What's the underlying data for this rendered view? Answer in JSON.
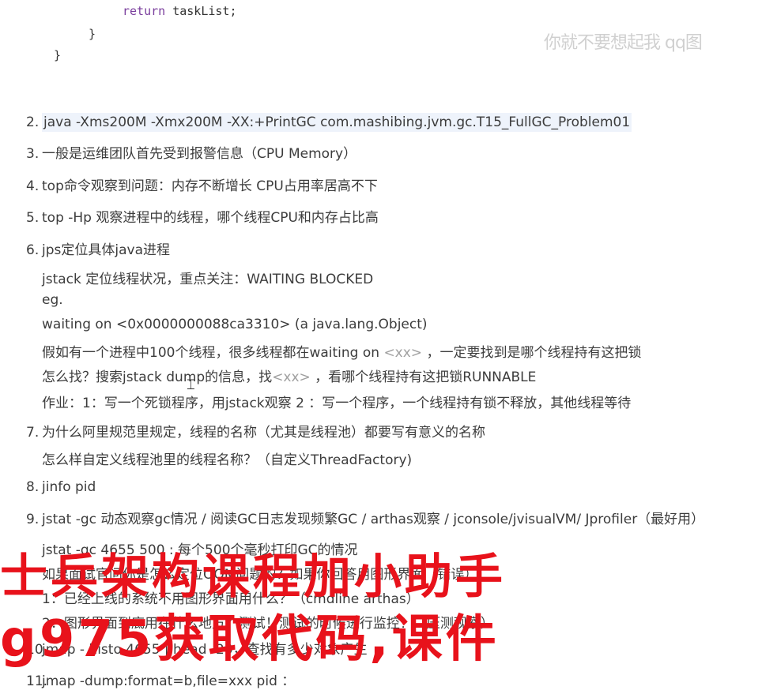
{
  "code": {
    "return_keyword": "return",
    "return_rest": " taskList;",
    "brace_inner": "}",
    "brace_outer": "}"
  },
  "watermark_top": "你就不要想起我 qq图",
  "items": [
    {
      "num": "2.",
      "text": "java -Xms200M -Xmx200M -XX:+PrintGC com.mashibing.jvm.gc.T15_FullGC_Problem01"
    },
    {
      "num": "3.",
      "text": "一般是运维团队首先受到报警信息（CPU Memory）"
    },
    {
      "num": "4.",
      "text": "top命令观察到问题：内存不断增长 CPU占用率居高不下"
    },
    {
      "num": "5.",
      "text": "top -Hp 观察进程中的线程，哪个线程CPU和内存占比高"
    },
    {
      "num": "6.",
      "text": "jps定位具体java进程"
    },
    {
      "num": "7.",
      "text": "为什么阿里规范里规定，线程的名称（尤其是线程池）都要写有意义的名称"
    },
    {
      "num": "8.",
      "text": "jinfo pid"
    },
    {
      "num": "9.",
      "text": "jstat -gc 动态观察gc情况 / 阅读GC日志发现频繁GC / arthas观察 / jconsole/jvisualVM/ Jprofiler（最好用）"
    },
    {
      "num": "10.",
      "text": "jmap - histo 4655 | head -20，查找有多少对象产生"
    },
    {
      "num": "11.",
      "text": "jmap -dump:format=b,file=xxx pid ："
    }
  ],
  "item6_sub": {
    "l1": "jstack 定位线程状况，重点关注：WAITING BLOCKED",
    "l2": "eg.",
    "l3": "waiting on <0x0000000088ca3310> (a java.lang.Object)",
    "l4a": "假如有一个进程中100个线程，很多线程都在waiting on ",
    "l4b": "<xx>",
    "l4c": " ，一定要找到是哪个线程持有这把锁",
    "l5a": "怎么找？搜索jstack dump的信息，找",
    "l5b": "<xx>",
    "l5c": " ，看哪个线程持有这把锁RUNNABLE",
    "l6": "作业：1：写一个死锁程序，用jstack观察 2 ：写一个程序，一个线程持有锁不释放，其他线程等待"
  },
  "item7_sub": "怎么样自定义线程池里的线程名称？（自定义ThreadFactory)",
  "item9_sub": {
    "l1": "jstat -gc 4655 500 : 每个500个毫秒打印GC的情况",
    "l2": "如果面试官问你是怎么定位OOM问题的？如果你回答用图形界面（错误）",
    "l3": "1：已经上线的系统不用图形界面用什么？（cmdline arthas）",
    "l4": "2：图形界面到底用在什么地方？测试！测试的时候进行监控！（压测观察）"
  },
  "overlay": {
    "line1": "士兵架构课程加小助手",
    "line2": "g975获取代码,课件"
  }
}
